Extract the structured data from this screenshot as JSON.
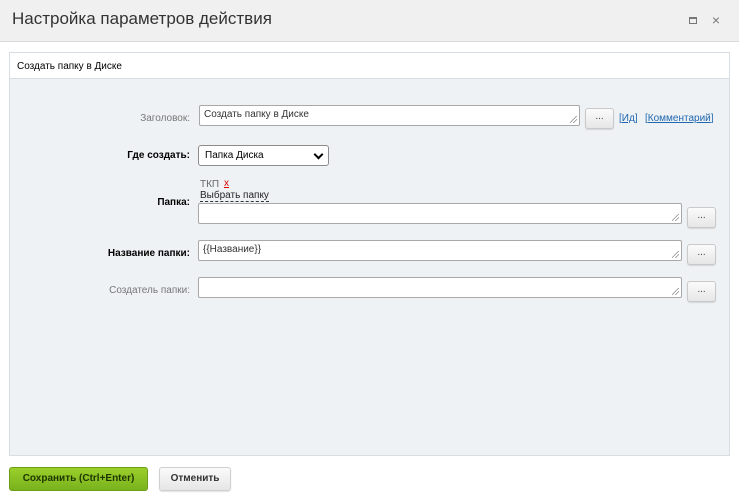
{
  "dialog": {
    "title": "Настройка параметров действия",
    "maximize_glyph": "",
    "close_glyph": "×"
  },
  "panel": {
    "title": "Создать папку в Диске"
  },
  "form": {
    "heading": {
      "label": "Заголовок:",
      "value": "Создать папку в Диске",
      "dots_label": "...",
      "id_link": "Ид",
      "comment_link": "Комментарий"
    },
    "where": {
      "label": "Где создать:",
      "selected": "Папка Диска"
    },
    "folder": {
      "label": "Папка:",
      "token": "ТКП",
      "token_remove": "x",
      "pick_link": "Выбрать папку",
      "value": "",
      "dots_label": "..."
    },
    "folder_name": {
      "label": "Название папки:",
      "value": "{{Название}}",
      "dots_label": "..."
    },
    "creator": {
      "label": "Создатель папки:",
      "value": "",
      "dots_label": "..."
    }
  },
  "footer": {
    "save_label": "Сохранить (Ctrl+Enter)",
    "cancel_label": "Отменить"
  },
  "colors": {
    "accent_green": "#8cc225",
    "link_blue": "#2067b0",
    "remove_red": "#dd0000"
  }
}
